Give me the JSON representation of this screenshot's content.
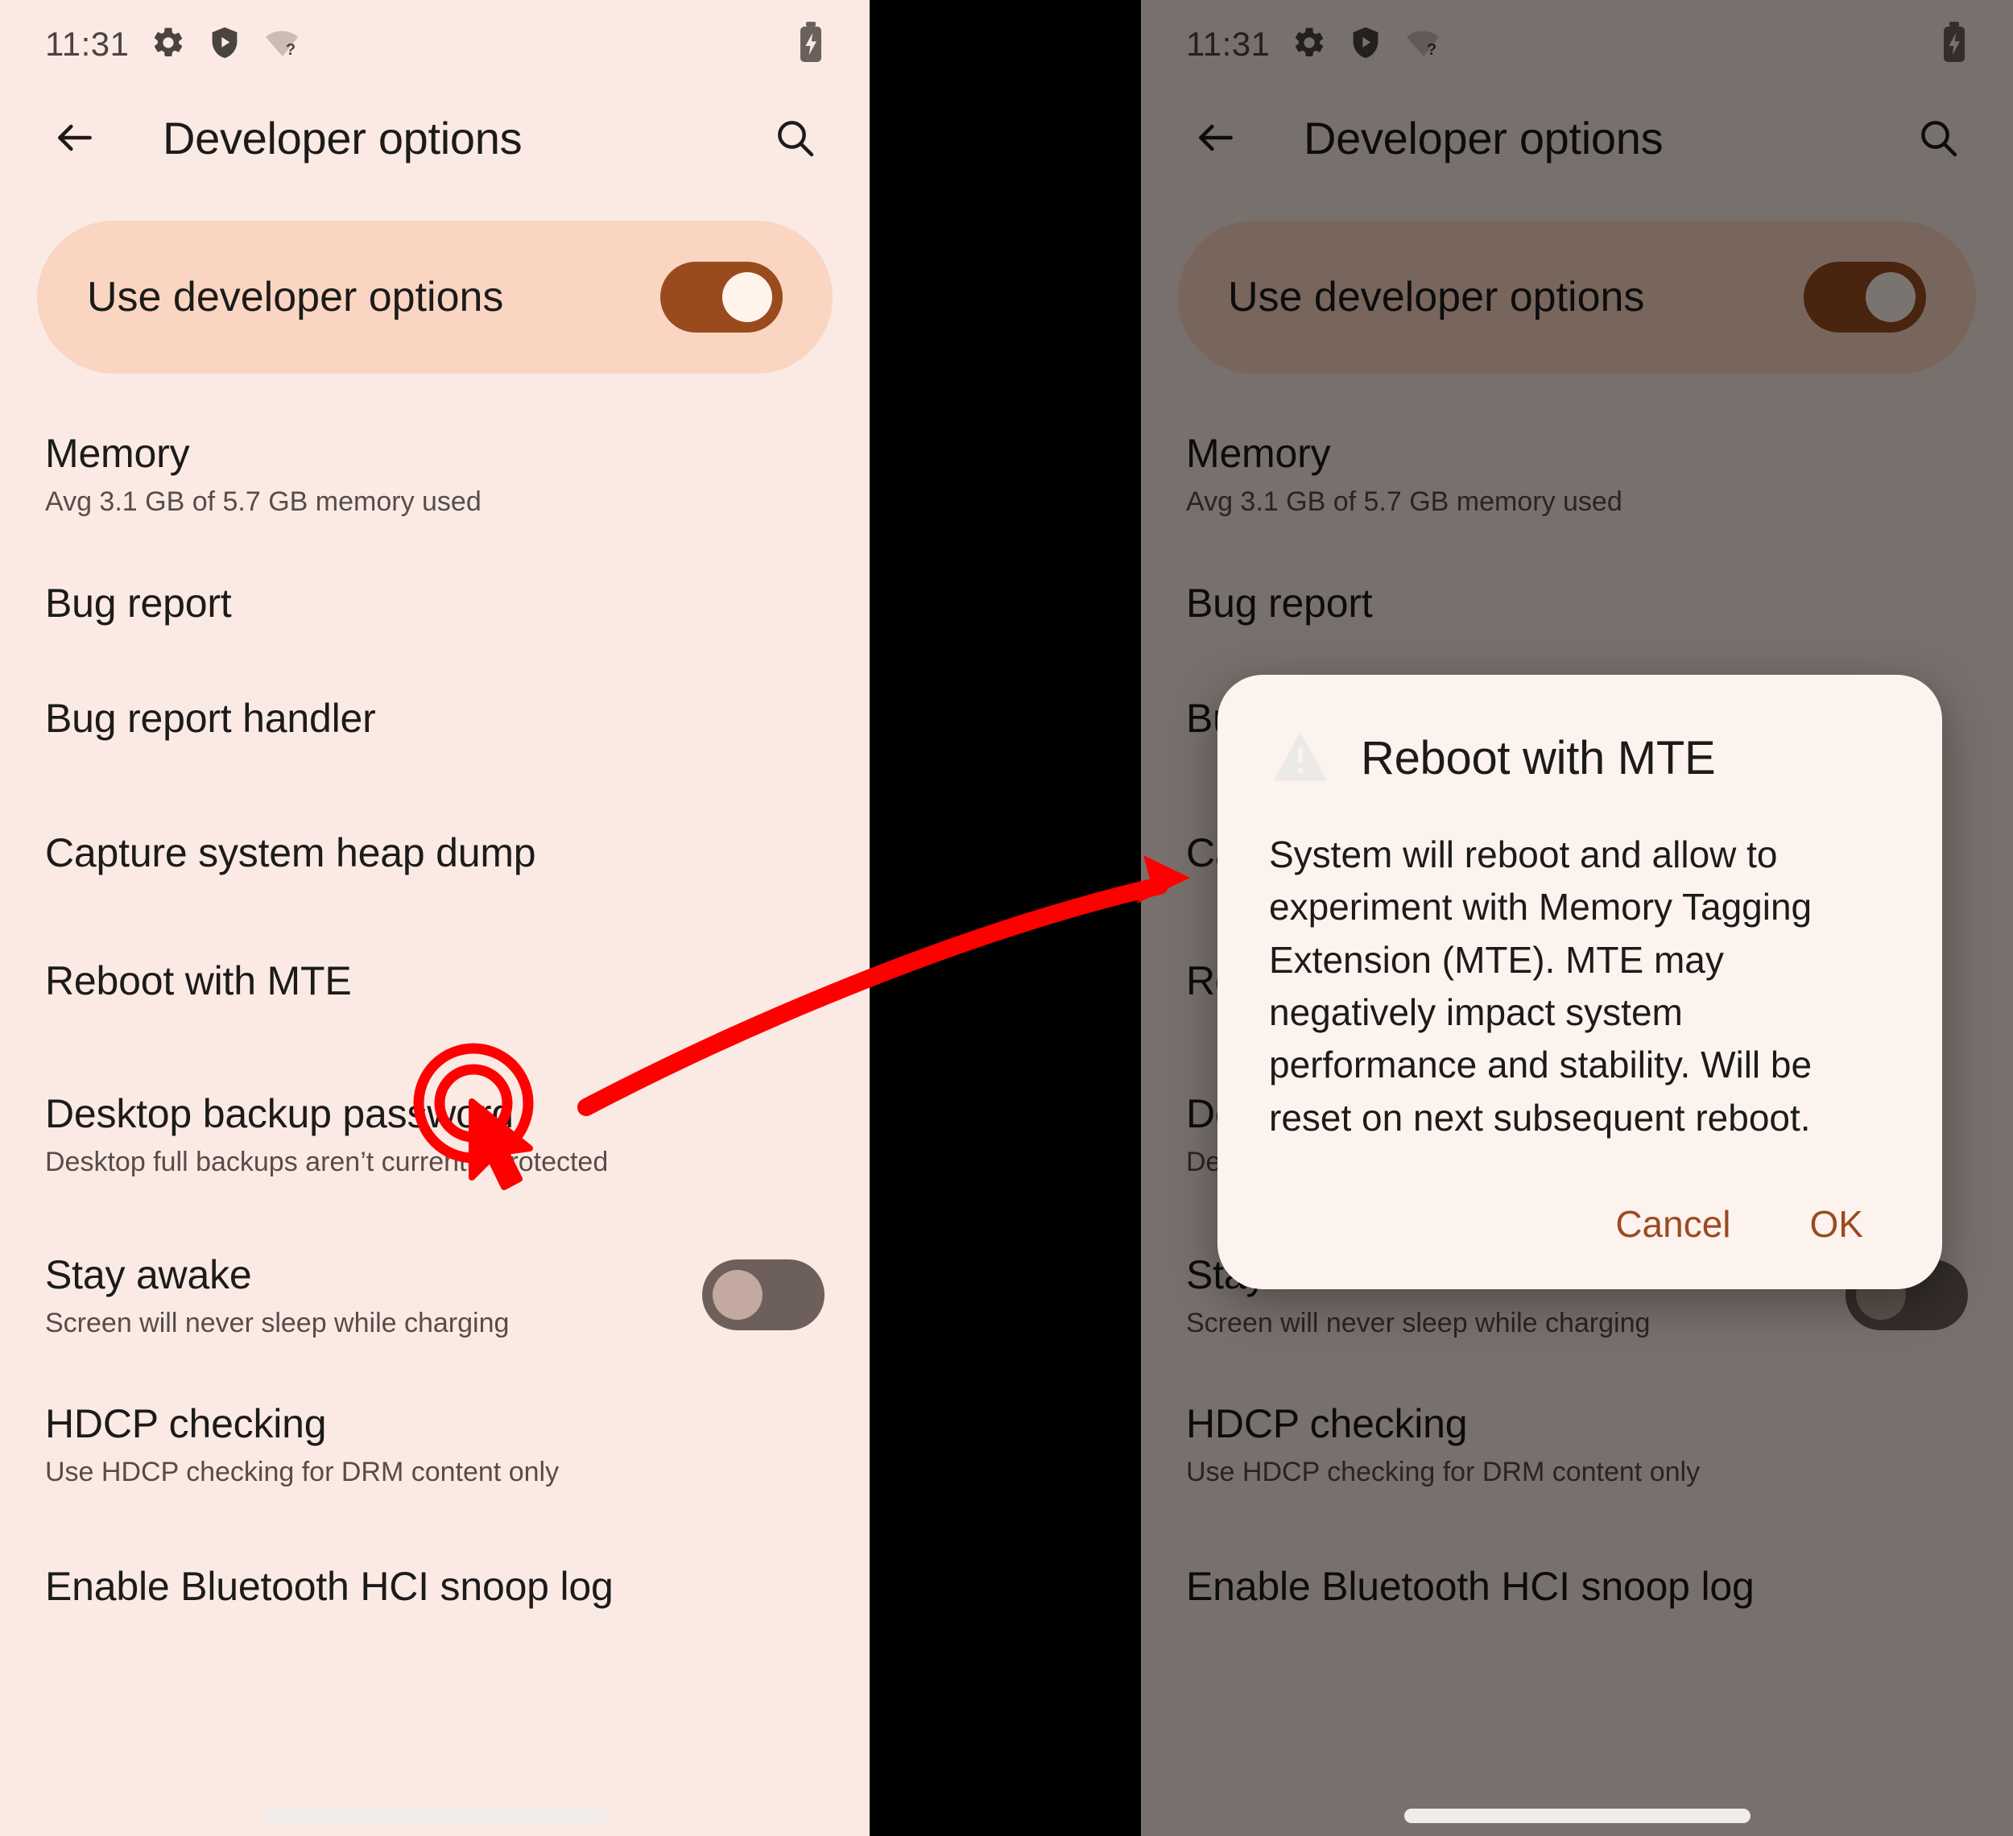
{
  "accent": {
    "toggle_on": "#9a4b1e",
    "dialog_button": "#9c4a21",
    "annotation_red": "#ff0000",
    "panel_bg": "#fbeae4",
    "hero_bg": "#fad6c2",
    "dialog_bg": "#fdf3ee"
  },
  "statusbar": {
    "time": "11:31",
    "icons": [
      "gear-icon",
      "shield-play-icon",
      "wifi-question-icon"
    ],
    "battery": "battery-charging-icon"
  },
  "appbar": {
    "back": "back-arrow-icon",
    "title": "Developer options",
    "search": "search-icon"
  },
  "hero": {
    "label": "Use developer options",
    "toggle_state": "on"
  },
  "rows": [
    {
      "title": "Memory",
      "sub": "Avg 3.1 GB of 5.7 GB memory used",
      "toggle": null
    },
    {
      "title": "Bug report",
      "sub": "",
      "toggle": null
    },
    {
      "title": "Bug report handler",
      "sub": "",
      "toggle": null
    },
    {
      "title": "Capture system heap dump",
      "sub": "",
      "toggle": null
    },
    {
      "title": "Reboot with MTE",
      "sub": "",
      "toggle": null
    },
    {
      "title": "Desktop backup password",
      "sub": "Desktop full backups aren’t currently protected",
      "toggle": null
    },
    {
      "title": "Stay awake",
      "sub": "Screen will never sleep while charging",
      "toggle": "off"
    },
    {
      "title": "HDCP checking",
      "sub": "Use HDCP checking for DRM content only",
      "toggle": null
    },
    {
      "title": "Enable Bluetooth HCI snoop log",
      "sub": "",
      "toggle": null
    }
  ],
  "dialog": {
    "icon": "warning-triangle-icon",
    "title": "Reboot with MTE",
    "body": "System will reboot and allow to experiment with Memory Tagging Extension (MTE). MTE may negatively impact system performance and stability. Will be reset on next subsequent reboot.",
    "cancel_label": "Cancel",
    "ok_label": "OK"
  },
  "annotation": {
    "tap_target_row": "Reboot with MTE",
    "cursor": "click-cursor-icon",
    "arrow": "curved-arrow-icon"
  }
}
